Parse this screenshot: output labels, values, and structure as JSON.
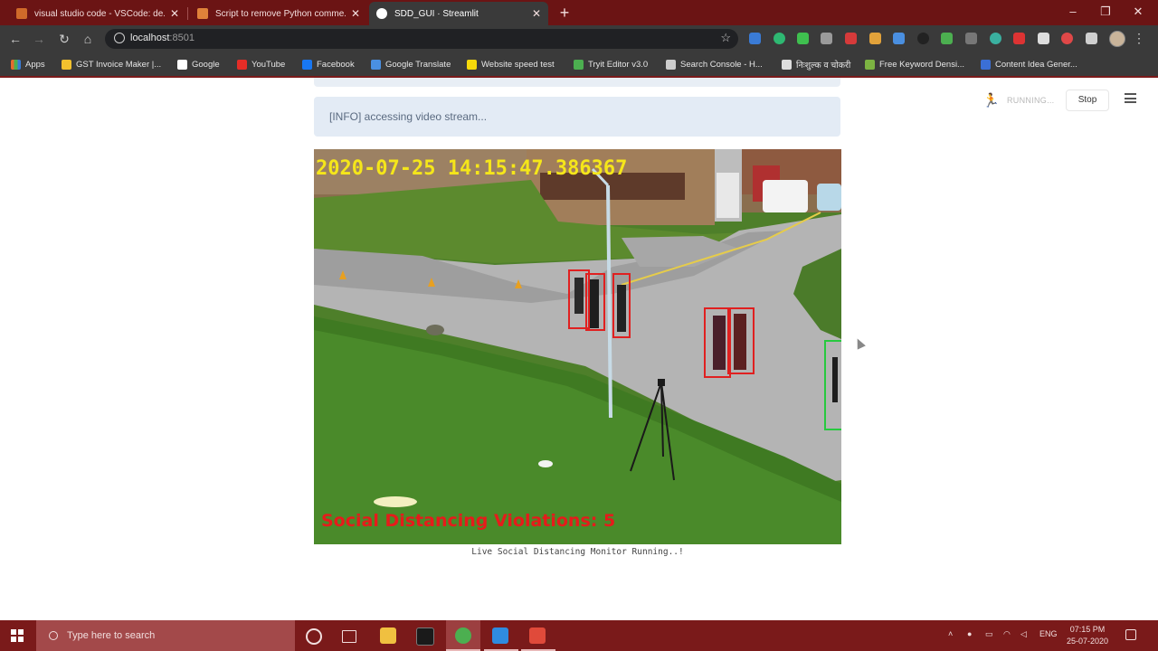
{
  "browser": {
    "tabs": [
      {
        "title": "visual studio code - VSCode: de..."
      },
      {
        "title": "Script to remove Python comme..."
      },
      {
        "title": "SDD_GUI · Streamlit"
      }
    ],
    "new_tab": "+",
    "window_controls": {
      "minimize": "–",
      "maximize": "❐",
      "close": "✕"
    },
    "url_host": "localhost",
    "url_port": ":8501",
    "bookmarks": [
      {
        "label": "Apps",
        "icon": "apps-grid-icon",
        "color": "#e66b2e"
      },
      {
        "label": "GST Invoice Maker |...",
        "icon": "gst-icon",
        "color": "#f2c12e"
      },
      {
        "label": "Google",
        "icon": "google-icon",
        "color": "#ffffff"
      },
      {
        "label": "YouTube",
        "icon": "youtube-icon",
        "color": "#e52d27"
      },
      {
        "label": "Facebook",
        "icon": "facebook-icon",
        "color": "#1877f2"
      },
      {
        "label": "Google Translate",
        "icon": "translate-icon",
        "color": "#4a90e2"
      },
      {
        "label": "Website speed test",
        "icon": "speedtest-icon",
        "color": "#f5d90a"
      },
      {
        "label": "Tryit Editor v3.0",
        "icon": "tryit-icon",
        "color": "#4caf50"
      },
      {
        "label": "Search Console - H...",
        "icon": "search-console-icon",
        "color": "#cccccc"
      },
      {
        "label": "निःशुल्क व चोकरी",
        "icon": "doc-icon",
        "color": "#dddddd"
      },
      {
        "label": "Free Keyword Densi...",
        "icon": "keyword-icon",
        "color": "#7cb342"
      },
      {
        "label": "Content Idea Gener...",
        "icon": "content-idea-icon",
        "color": "#3b6fd6"
      }
    ]
  },
  "app": {
    "status": "RUNNING...",
    "stop_label": "Stop",
    "info_message": "[INFO] accessing video stream...",
    "video": {
      "timestamp": "2020-07-25 14:15:47.386367",
      "violations_text": "Social Distancing Violations: 5",
      "violations_count": 5
    },
    "caption": "Live Social Distancing Monitor Running..!"
  },
  "taskbar": {
    "search_placeholder": "Type here to search",
    "language": "ENG",
    "time": "07:15 PM",
    "date": "25-07-2020"
  },
  "colors": {
    "chrome_frame": "#6b1414",
    "taskbar": "#7a1a1a",
    "info_bg": "#e3ebf5",
    "violation_box": "#e02020",
    "safe_box": "#27c93f",
    "timestamp_text": "#f5e61a"
  }
}
